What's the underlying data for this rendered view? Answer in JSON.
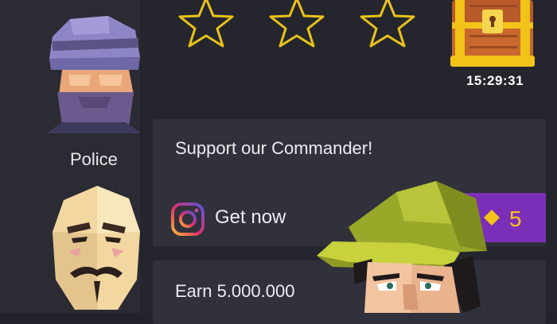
{
  "sidebar": {
    "characters": [
      {
        "name": "Police",
        "icon": "police-avatar"
      },
      {
        "name": "",
        "icon": "anonymous-mask-avatar"
      }
    ]
  },
  "header": {
    "stars_total": 3,
    "stars_earned": 0,
    "chest": {
      "icon": "treasure-chest-icon",
      "timer": "15:29:31"
    }
  },
  "cards": {
    "support": {
      "title": "Support our Commander!",
      "action_label": "Get now",
      "action_icon": "instagram-icon",
      "reward": "5",
      "reward_icon": "gem-icon"
    },
    "earn": {
      "title": "Earn 5.000.000"
    }
  },
  "colors": {
    "background": "#23242b",
    "card": "#30313a",
    "star_outline": "#e8c21a",
    "reward_button": "#7b2fb8",
    "reward_text": "#f4c21a"
  }
}
